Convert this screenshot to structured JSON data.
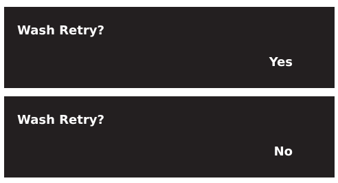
{
  "panels": [
    {
      "prompt": "Wash Retry?",
      "value": "Yes"
    },
    {
      "prompt": "Wash Retry?",
      "value": "No"
    }
  ],
  "colors": {
    "panel_background": "#231f20",
    "text": "#ffffff",
    "page_background": "#ffffff"
  }
}
